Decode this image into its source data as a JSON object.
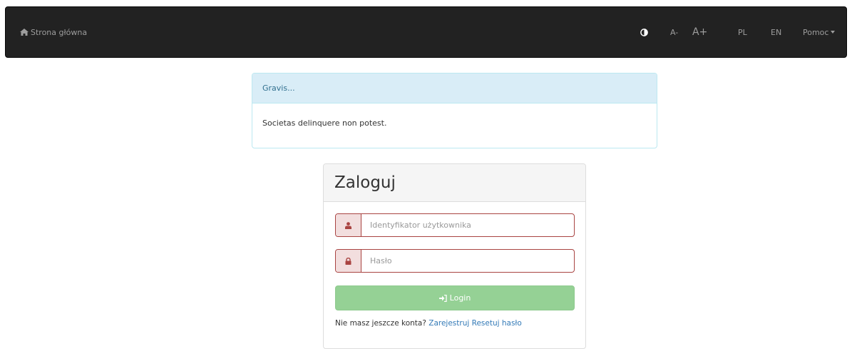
{
  "navbar": {
    "brand_label": "Strona główna",
    "items": [
      {
        "label": "A-"
      },
      {
        "label": "A+"
      },
      {
        "label": "PL"
      },
      {
        "label": "EN"
      },
      {
        "label": "Pomoc"
      }
    ],
    "contrast_icon": "contrast-icon"
  },
  "alert": {
    "title": "Gravis...",
    "message": "Societas delinquere non potest."
  },
  "login": {
    "title": "Zaloguj",
    "username_placeholder": "Identyfikator użytkownika",
    "username_value": "",
    "password_placeholder": "Hasło",
    "password_value": "",
    "button_label": "Login",
    "no_account_text": "Nie masz jeszcze konta?",
    "register_link": "Zarejestruj",
    "reset_link": "Resetuj hasło"
  },
  "colors": {
    "navbar_bg": "#222222",
    "alert_info_bg": "#d9edf7",
    "error_border": "#a94442",
    "button_success_disabled": "#95d195",
    "link": "#337ab7"
  }
}
